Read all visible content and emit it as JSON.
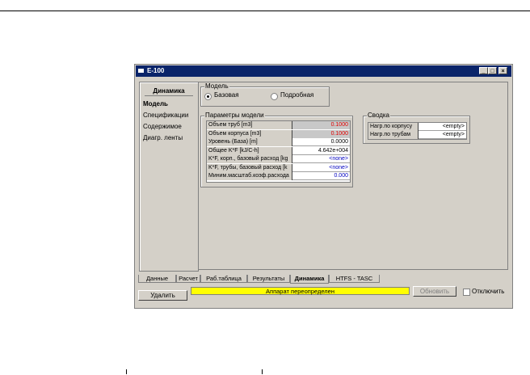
{
  "window": {
    "title": "E-100",
    "minimize": "_",
    "maximize": "□",
    "close": "×"
  },
  "nav": {
    "header": "Динамика",
    "items": [
      "Модель",
      "Спецификации",
      "Содержимое",
      "Диагр. ленты"
    ]
  },
  "model": {
    "group_label": "Модель",
    "option_basic": "Базовая",
    "option_detailed": "Подробная"
  },
  "params": {
    "group_label": "Параметры модели",
    "rows": [
      {
        "label": "Объем труб [m3]",
        "value": "0.1000",
        "color": "#e00000"
      },
      {
        "label": "Объем корпуса [m3]",
        "value": "0.1000",
        "color": "#e00000"
      },
      {
        "label": "Уровень (База) [m]",
        "value": "0.0000",
        "color": "#000000"
      },
      {
        "label": "Общее K*F [kJ/C-h]",
        "value": "4.642e+004",
        "color": "#000000"
      },
      {
        "label": "K*F, корп., базовый расход [kg",
        "value": "<none>",
        "color": "#0000c0"
      },
      {
        "label": "K*F, трубы, базовый расход [k",
        "value": "<none>",
        "color": "#0000c0"
      },
      {
        "label": "Миним.масштаб.коэф.расхода",
        "value": "0.000",
        "color": "#0000c0"
      }
    ]
  },
  "summary": {
    "group_label": "Сводка",
    "rows": [
      {
        "label": "Нагр.по корпусу",
        "value": "<empty>"
      },
      {
        "label": "Нагр.по трубам",
        "value": "<empty>"
      }
    ]
  },
  "tabs": [
    "Данные",
    "Расчет",
    "Раб.таблица",
    "Результаты",
    "Динамика",
    "HTFS - TASC"
  ],
  "active_tab": "Динамика",
  "footer": {
    "delete_button": "Удалить",
    "status": "Аппарат переопределен",
    "status_color": "#ffff00",
    "update_button": "Обновить",
    "disable_label": "Отключить"
  }
}
